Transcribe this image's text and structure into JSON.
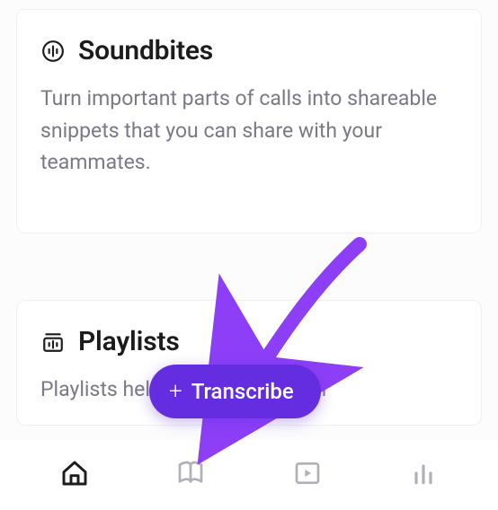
{
  "cards": {
    "soundbites": {
      "title": "Soundbites",
      "description": "Turn important parts of calls into shareable snippets that you can share with your teammates."
    },
    "playlists": {
      "title": "Playlists",
      "description": "Playlists help you organize your"
    }
  },
  "fab": {
    "label": "Transcribe",
    "plus": "+"
  },
  "nav": {
    "home": "home-icon",
    "library": "book-icon",
    "play": "play-icon",
    "stats": "bars-icon"
  },
  "colors": {
    "accent": "#642EE0",
    "text": "#1c1c1e",
    "muted": "#7a7a85"
  }
}
